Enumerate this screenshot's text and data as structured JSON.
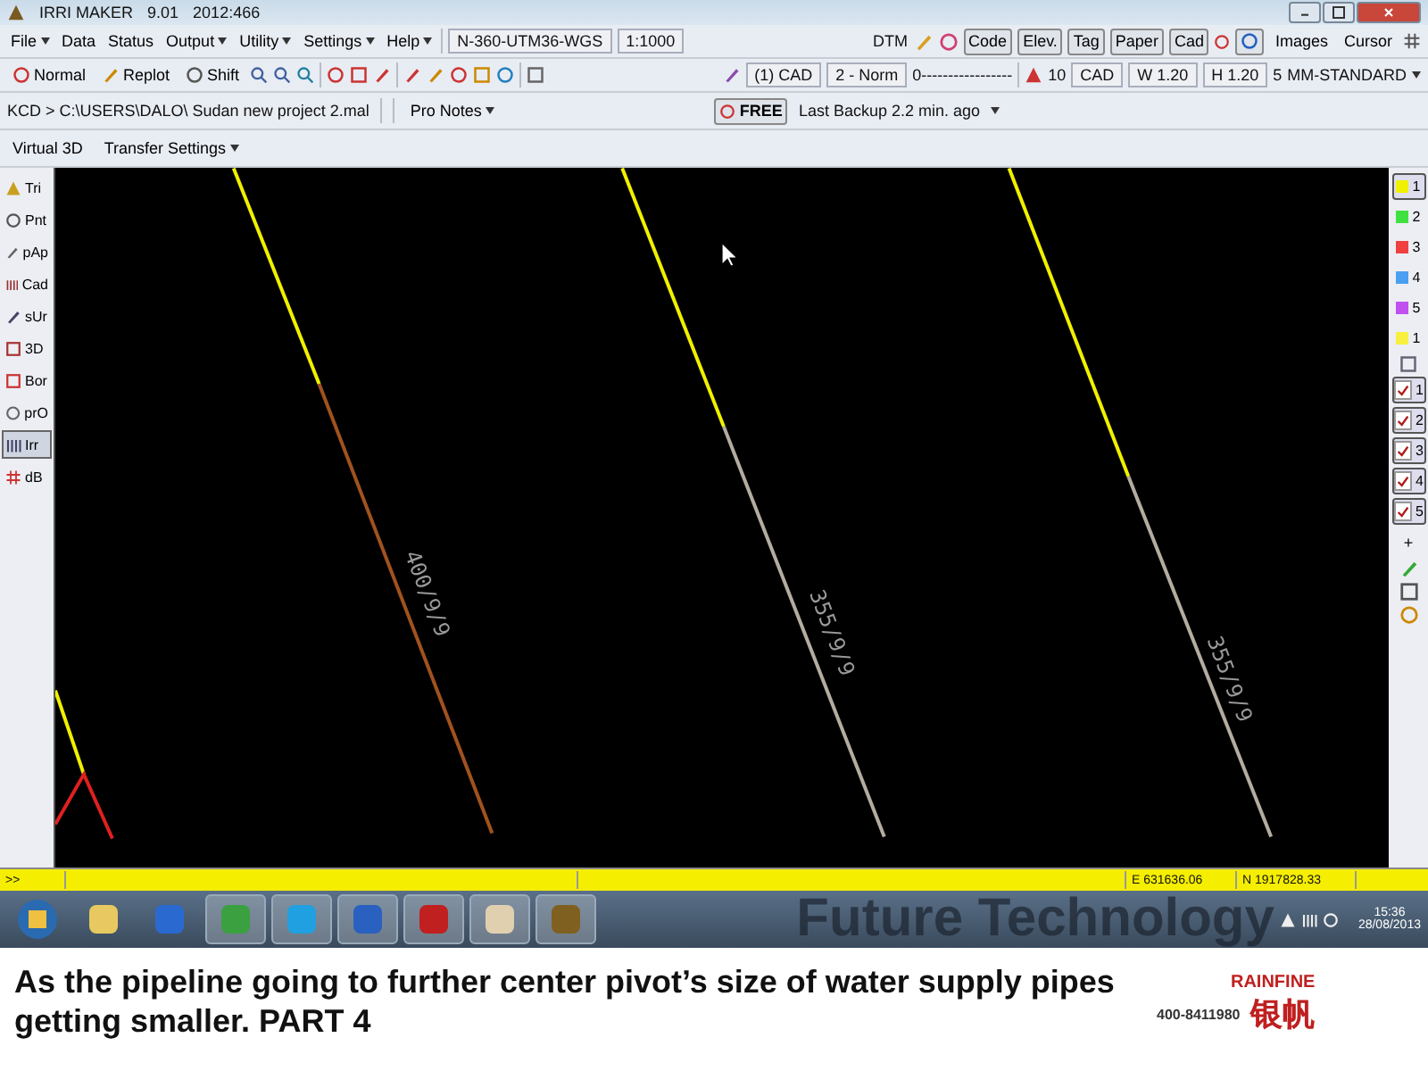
{
  "window": {
    "title": "IRRI MAKER",
    "version": "9.01",
    "build": "2012:466"
  },
  "menu": [
    {
      "label": "File",
      "dropdown": true
    },
    {
      "label": "Data",
      "dropdown": false
    },
    {
      "label": "Status",
      "dropdown": false
    },
    {
      "label": "Output",
      "dropdown": true
    },
    {
      "label": "Utility",
      "dropdown": true
    },
    {
      "label": "Settings",
      "dropdown": true
    },
    {
      "label": "Help",
      "dropdown": true
    }
  ],
  "projection": "N-360-UTM36-WGS",
  "scale": "1:1000",
  "top_right": {
    "label": "DTM",
    "buttons": [
      "Code",
      "Elev.",
      "Tag",
      "Paper",
      "Cad"
    ],
    "links": [
      "Images",
      "Cursor"
    ]
  },
  "toolbar": {
    "tools": [
      "Normal",
      "Replot",
      "Shift"
    ],
    "layer": "(1) CAD",
    "mode": "2 - Norm",
    "line_type": "0-----------------",
    "text_size": "10",
    "text_layer": "CAD",
    "width": "W 1.20",
    "height": "H 1.20",
    "count": "5",
    "style": "MM-STANDARD"
  },
  "path_bar": {
    "path": "KCD > C:\\USERS\\DALO\\ Sudan new project 2.mal",
    "notes": "Pro Notes",
    "free": "FREE",
    "backup": "Last Backup 2.2 min. ago"
  },
  "second_bar": [
    "Virtual 3D",
    "Transfer Settings"
  ],
  "left_tools": [
    {
      "label": "Tri",
      "selected": false
    },
    {
      "label": "Pnt",
      "selected": false
    },
    {
      "label": "pAp",
      "selected": false
    },
    {
      "label": "Cad",
      "selected": false
    },
    {
      "label": "sUr",
      "selected": false
    },
    {
      "label": "3D",
      "selected": false
    },
    {
      "label": "Bor",
      "selected": false
    },
    {
      "label": "prO",
      "selected": false
    },
    {
      "label": "Irr",
      "selected": true
    },
    {
      "label": "dB",
      "selected": false
    }
  ],
  "layers": [
    {
      "label": "1",
      "color": "#f0f000",
      "selected": true
    },
    {
      "label": "2",
      "color": "#40e040",
      "selected": false
    },
    {
      "label": "3",
      "color": "#f04040",
      "selected": false
    },
    {
      "label": "4",
      "color": "#4aa0f0",
      "selected": false
    },
    {
      "label": "5",
      "color": "#c050f0",
      "selected": false
    },
    {
      "label": "1",
      "color": "#f8f040",
      "selected": false
    }
  ],
  "checks": [
    {
      "label": "1",
      "checked": true
    },
    {
      "label": "2",
      "checked": true
    },
    {
      "label": "3",
      "checked": true
    },
    {
      "label": "4",
      "checked": true
    },
    {
      "label": "5",
      "checked": true
    }
  ],
  "add_label": "+",
  "pipes": [
    {
      "label": "400/9/9",
      "color": "#a0521e"
    },
    {
      "label": "355/9/9",
      "color": "#b4aca0"
    },
    {
      "label": "355/9/9",
      "color": "#b4aca0"
    }
  ],
  "status_bar": {
    "prompt": ">>",
    "easting": "E 631636.06",
    "northing": "N 1917828.33"
  },
  "taskbar": {
    "background_text": "Future Technology",
    "time": "15:36",
    "date": "28/08/2013"
  },
  "caption": "As the pipeline going to further center pivot’s size of water supply pipes getting smaller. PART 4",
  "logo": {
    "brand": "RAINFINE",
    "phone": "400-8411980",
    "chinese": "银帆"
  }
}
